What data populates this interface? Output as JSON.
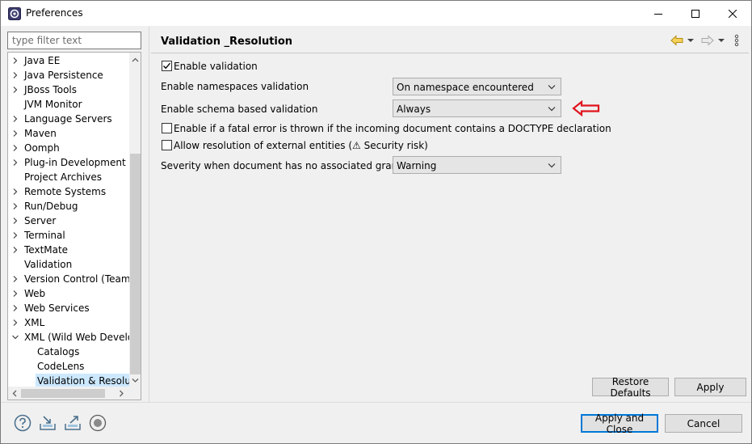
{
  "window": {
    "title": "Preferences",
    "icon": "eclipse-preferences-icon"
  },
  "filter": {
    "placeholder": "type filter text",
    "value": ""
  },
  "tree": {
    "items": [
      {
        "label": "Java EE",
        "expandable": true,
        "expanded": false,
        "level": 0
      },
      {
        "label": "Java Persistence",
        "expandable": true,
        "expanded": false,
        "level": 0
      },
      {
        "label": "JBoss Tools",
        "expandable": true,
        "expanded": false,
        "level": 0
      },
      {
        "label": "JVM Monitor",
        "expandable": false,
        "expanded": false,
        "level": 0
      },
      {
        "label": "Language Servers",
        "expandable": true,
        "expanded": false,
        "level": 0
      },
      {
        "label": "Maven",
        "expandable": true,
        "expanded": false,
        "level": 0
      },
      {
        "label": "Oomph",
        "expandable": true,
        "expanded": false,
        "level": 0
      },
      {
        "label": "Plug-in Development",
        "expandable": true,
        "expanded": false,
        "level": 0
      },
      {
        "label": "Project Archives",
        "expandable": false,
        "expanded": false,
        "level": 0
      },
      {
        "label": "Remote Systems",
        "expandable": true,
        "expanded": false,
        "level": 0
      },
      {
        "label": "Run/Debug",
        "expandable": true,
        "expanded": false,
        "level": 0
      },
      {
        "label": "Server",
        "expandable": true,
        "expanded": false,
        "level": 0
      },
      {
        "label": "Terminal",
        "expandable": true,
        "expanded": false,
        "level": 0
      },
      {
        "label": "TextMate",
        "expandable": true,
        "expanded": false,
        "level": 0
      },
      {
        "label": "Validation",
        "expandable": false,
        "expanded": false,
        "level": 0
      },
      {
        "label": "Version Control (Team)",
        "expandable": true,
        "expanded": false,
        "level": 0
      },
      {
        "label": "Web",
        "expandable": true,
        "expanded": false,
        "level": 0
      },
      {
        "label": "Web Services",
        "expandable": true,
        "expanded": false,
        "level": 0
      },
      {
        "label": "XML",
        "expandable": true,
        "expanded": false,
        "level": 0
      },
      {
        "label": "XML (Wild Web Develop",
        "expandable": true,
        "expanded": true,
        "level": 0
      },
      {
        "label": "Catalogs",
        "expandable": false,
        "expanded": false,
        "level": 1
      },
      {
        "label": "CodeLens",
        "expandable": false,
        "expanded": false,
        "level": 1
      },
      {
        "label": "Validation & Resoluti",
        "expandable": false,
        "expanded": false,
        "level": 1,
        "selected": true
      }
    ]
  },
  "page": {
    "title": "Validation _Resolution",
    "enable_validation": {
      "label": "Enable validation",
      "checked": true
    },
    "namespaces": {
      "label": "Enable namespaces validation",
      "value": "On namespace encountered"
    },
    "schema": {
      "label": "Enable schema based validation",
      "value": "Always"
    },
    "doctype": {
      "label": "Enable if a fatal error is thrown if the incoming document contains a DOCTYPE declaration",
      "checked": false
    },
    "external": {
      "label": "Allow resolution of external entities (⚠ Security risk)",
      "checked": false
    },
    "severity": {
      "label": "Severity when document has no associated grammar",
      "value": "Warning"
    }
  },
  "buttons": {
    "restore_defaults": "Restore Defaults",
    "apply": "Apply",
    "apply_close": "Apply and Close",
    "cancel": "Cancel"
  },
  "colors": {
    "accent": "#0078d7",
    "annotation_arrow": "#e0141e",
    "selection": "#cce8ff",
    "nav_back": "#e8b92a"
  }
}
